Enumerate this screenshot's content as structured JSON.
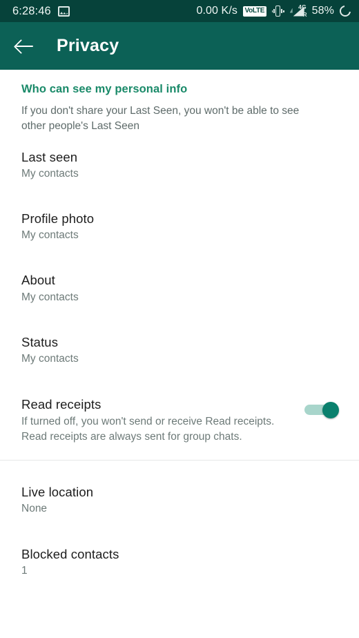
{
  "statusbar": {
    "clock": "6:28:46",
    "screenshot_icon": "screenshot-icon",
    "net_speed": "0.00 K/s",
    "volte_badge": "VoLTE",
    "vibrate_icon": "vibrate-icon",
    "network_type": "4G",
    "roaming": "R",
    "battery_percent": "58%",
    "battery_icon": "battery-circle-icon",
    "background": "#06423a"
  },
  "appbar": {
    "back_icon": "back-arrow-icon",
    "title": "Privacy",
    "background": "#0c6156",
    "text_color": "#ffffff"
  },
  "section": {
    "header": "Who can see my personal info",
    "header_color": "#1a8a69",
    "description": "If you don't share your Last Seen, you won't be able to see other people's Last Seen"
  },
  "rows": [
    {
      "title": "Last seen",
      "subtitle": "My contacts"
    },
    {
      "title": "Profile photo",
      "subtitle": "My contacts"
    },
    {
      "title": "About",
      "subtitle": "My contacts"
    },
    {
      "title": "Status",
      "subtitle": "My contacts"
    },
    {
      "title": "Read receipts",
      "subtitle": "If turned off, you won't send or receive Read receipts. Read receipts are always sent for group chats.",
      "toggle": {
        "state": "on",
        "track_color": "#a8d5cb",
        "thumb_color": "#0a806d"
      }
    },
    {
      "title": "Live location",
      "subtitle": "None"
    },
    {
      "title": "Blocked contacts",
      "subtitle": "1"
    }
  ]
}
